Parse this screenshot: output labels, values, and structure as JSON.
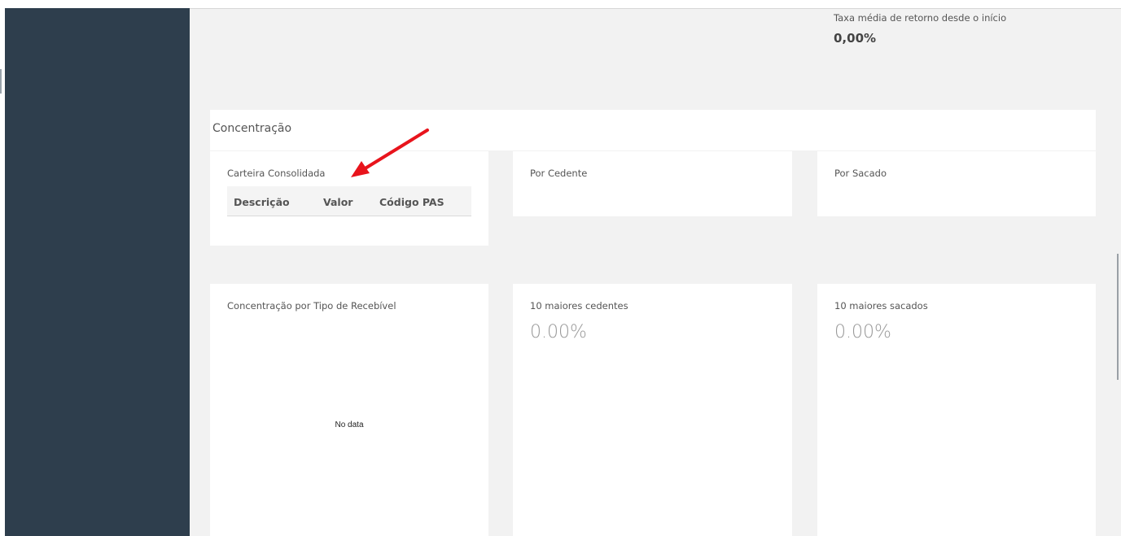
{
  "stats": {
    "return_label": "Taxa média de retorno desde o início",
    "return_value": "0,00%"
  },
  "concentracao": {
    "title": "Concentração",
    "carteira": {
      "title": "Carteira Consolidada",
      "columns": [
        "Descrição",
        "Valor",
        "Código PAS"
      ]
    },
    "por_cedente": {
      "title": "Por Cedente"
    },
    "por_sacado": {
      "title": "Por Sacado"
    }
  },
  "cards": {
    "tipo_recebivel": {
      "title": "Concentração por Tipo de Recebível",
      "empty": "No data"
    },
    "maiores_cedentes": {
      "title": "10 maiores cedentes",
      "value": "0.00%"
    },
    "maiores_sacados": {
      "title": "10 maiores sacados",
      "value": "0.00%"
    }
  },
  "annotation": {
    "arrow_color": "#e8141c"
  }
}
